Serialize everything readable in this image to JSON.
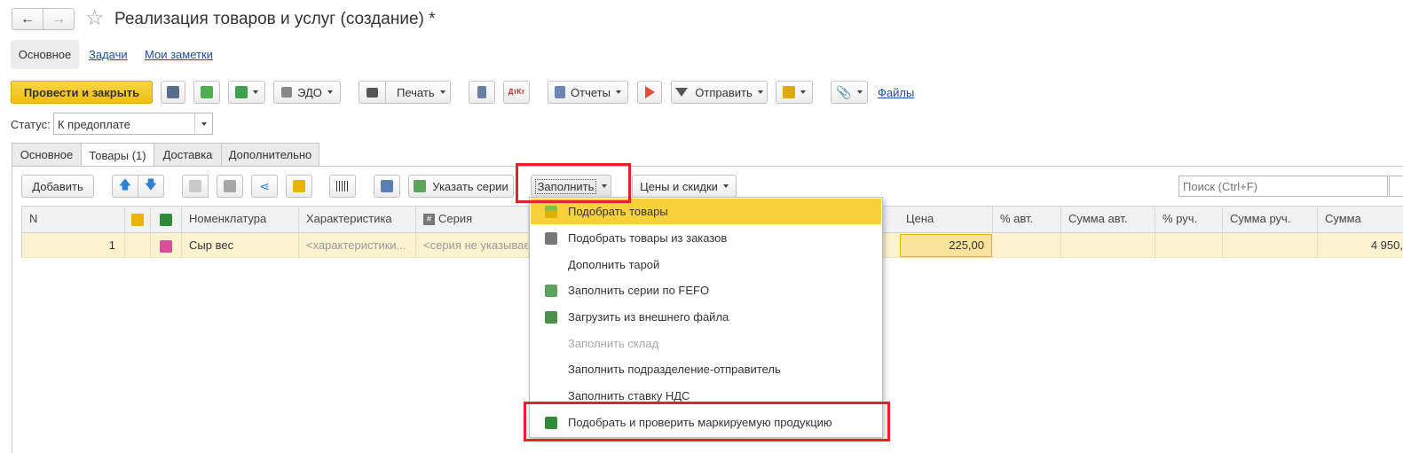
{
  "window": {
    "title": "Реализация товаров и услуг (создание) *"
  },
  "nav": {
    "back": "←",
    "forward": "→",
    "star": "☆"
  },
  "top_tabs": {
    "main": "Основное",
    "tasks": "Задачи",
    "notes": "Мои заметки"
  },
  "toolbar": {
    "post_close": "Провести и закрыть",
    "edo": "ЭДО",
    "print": "Печать",
    "dt_kt": "ДтКт",
    "reports": "Отчеты",
    "send": "Отправить",
    "files": "Файлы"
  },
  "status": {
    "label": "Статус:",
    "value": "К предоплате"
  },
  "doc_tabs": [
    "Основное",
    "Товары (1)",
    "Доставка",
    "Дополнительно"
  ],
  "table_toolbar": {
    "add": "Добавить",
    "series": "Указать серии",
    "fill": "Заполнить",
    "prices": "Цены и скидки",
    "search_placeholder": "Поиск (Ctrl+F)"
  },
  "columns": {
    "n": "N",
    "nomenclature": "Номенклатура",
    "characteristic": "Характеристика",
    "series": "Серия",
    "price": "Цена",
    "pct_auto": "% авт.",
    "sum_auto": "Сумма авт.",
    "pct_manual": "% руч.",
    "sum_manual": "Сумма руч.",
    "sum": "Сумма"
  },
  "rows": [
    {
      "n": "1",
      "nomenclature": "Сыр вес",
      "characteristic": "<характеристики...",
      "series": "<серия не указывае",
      "price": "225,00",
      "sum": "4 950,"
    }
  ],
  "fill_menu": [
    {
      "label": "Подобрать товары",
      "icon": "pick-goods-icon",
      "enabled": true,
      "highlighted": true
    },
    {
      "label": "Подобрать товары из заказов",
      "icon": "pick-from-orders-icon",
      "enabled": true
    },
    {
      "label": "Дополнить тарой",
      "icon": "",
      "enabled": true
    },
    {
      "label": "Заполнить серии по FEFO",
      "icon": "fefo-series-icon",
      "enabled": true
    },
    {
      "label": "Загрузить из внешнего файла",
      "icon": "load-file-icon",
      "enabled": true
    },
    {
      "label": "Заполнить склад",
      "icon": "",
      "enabled": false
    },
    {
      "label": "Заполнить подразделение-отправитель",
      "icon": "",
      "enabled": true
    },
    {
      "label": "Заполнить ставку НДС",
      "icon": "",
      "enabled": true
    },
    {
      "label": "Подобрать и проверить маркируемую продукцию",
      "icon": "marked-goods-icon",
      "enabled": true
    }
  ],
  "colors": {
    "accent_yellow": "#f5c518",
    "highlight_red": "#e8202a",
    "row_highlight": "#fbf3d0",
    "menu_highlight": "#f9d13a"
  }
}
